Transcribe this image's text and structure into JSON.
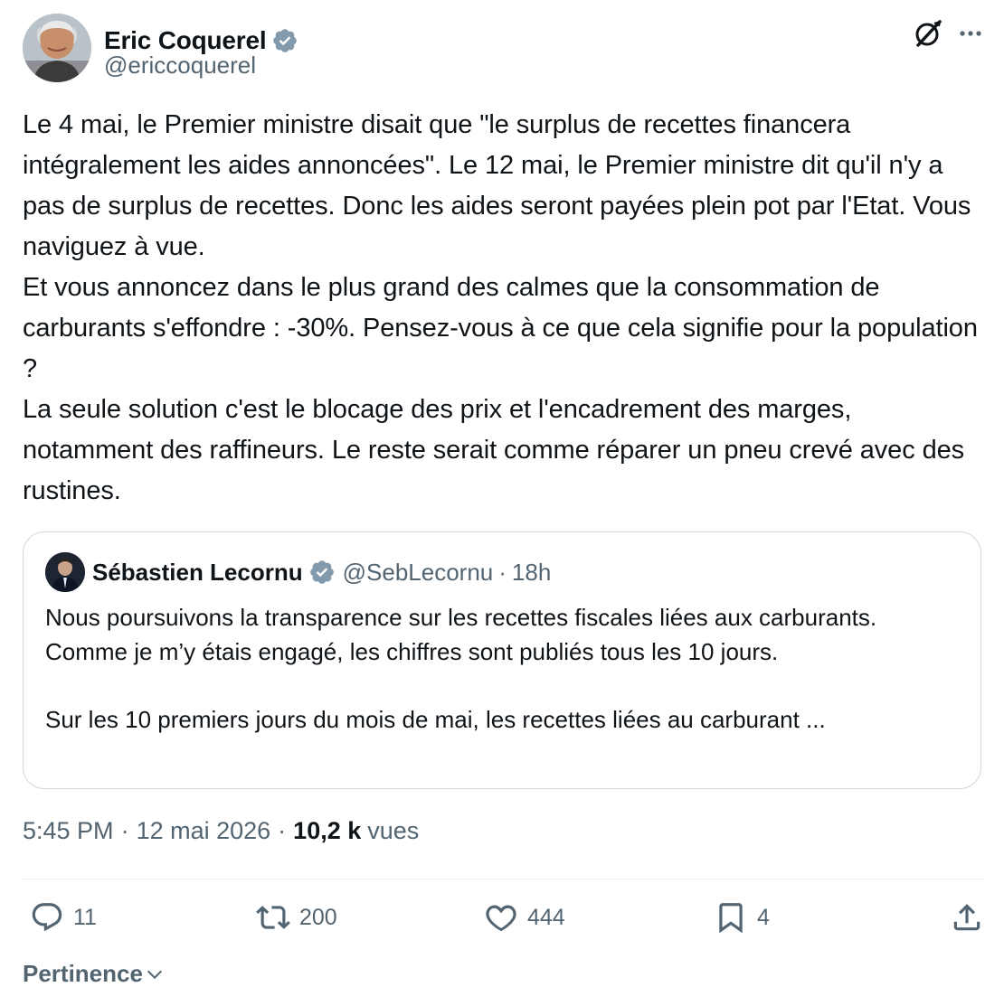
{
  "author": {
    "name": "Eric Coquerel",
    "handle": "@ericcoquerel"
  },
  "tweet": {
    "paragraphs": [
      "Le 4 mai, le Premier ministre disait que \"le surplus de recettes financera intégralement les aides annoncées\". Le 12 mai, le Premier ministre dit qu'il n'y a pas de surplus de recettes. Donc les aides seront payées plein pot par l'Etat. Vous naviguez à vue.",
      "Et vous annoncez dans le plus grand des calmes que la consommation de carburants s'effondre : -30%. Pensez-vous à ce que cela signifie pour la population ?",
      "La seule solution c'est le blocage des prix et l'encadrement des marges, notamment des raffineurs. Le reste serait comme réparer un pneu crevé avec des rustines."
    ]
  },
  "quoted": {
    "name": "Sébastien Lecornu",
    "handle": "@SebLecornu",
    "dot": "·",
    "time": "18h",
    "paragraph1": "Nous poursuivons la transparence sur les recettes fiscales liées aux carburants. Comme je m’y étais engagé, les chiffres sont publiés tous les 10 jours.",
    "paragraph2": "Sur les 10 premiers jours du mois de mai, les recettes liées au carburant ..."
  },
  "meta": {
    "time": "5:45 PM",
    "sep1": "·",
    "date": "12 mai 2026",
    "sep2": "·",
    "views_count": "10,2 k",
    "views_label": "vues"
  },
  "actions": {
    "replies": "11",
    "reposts": "200",
    "likes": "444",
    "bookmarks": "4"
  },
  "sort": {
    "label": "Pertinence"
  },
  "colors": {
    "text": "#0f1419",
    "secondary": "#536471",
    "verified": "#829aab",
    "border": "#cfd9de"
  },
  "icons": [
    "verified-badge-icon",
    "grok-icon",
    "more-icon",
    "reply-icon",
    "repost-icon",
    "like-icon",
    "bookmark-icon",
    "share-icon",
    "chevron-down-icon"
  ]
}
